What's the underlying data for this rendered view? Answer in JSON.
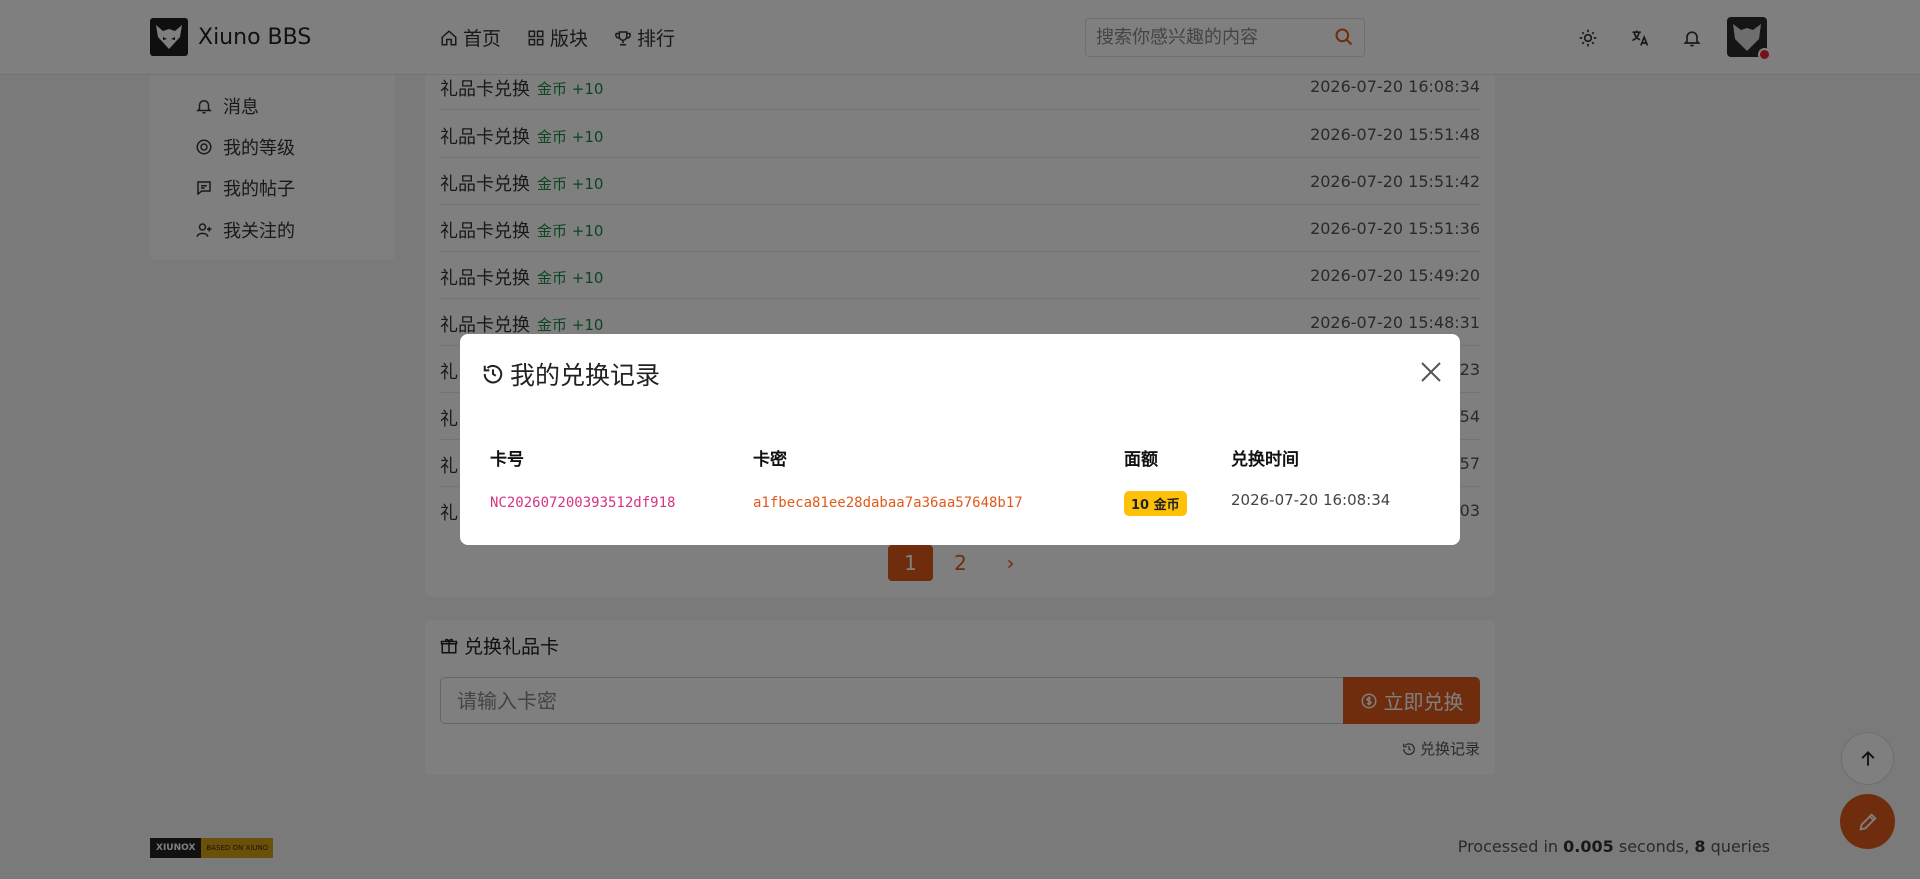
{
  "header": {
    "logo_text": "Xiuno BBS",
    "nav": [
      {
        "label": "首页",
        "icon": "home-icon"
      },
      {
        "label": "版块",
        "icon": "grid-icon"
      },
      {
        "label": "排行",
        "icon": "trophy-icon"
      }
    ],
    "search_placeholder": "搜索你感兴趣的内容",
    "icons": [
      "sun-icon",
      "translate-icon",
      "bell-icon"
    ]
  },
  "sidebar": {
    "items": [
      {
        "label": "消息",
        "icon": "bell-icon"
      },
      {
        "label": "我的等级",
        "icon": "level-icon"
      },
      {
        "label": "我的帖子",
        "icon": "comment-icon"
      },
      {
        "label": "我关注的",
        "icon": "user-plus-icon"
      }
    ]
  },
  "records": {
    "rows": [
      {
        "title": "礼品卡兑换",
        "gain": "金币 +10",
        "time": "2026-07-20 16:08:34"
      },
      {
        "title": "礼品卡兑换",
        "gain": "金币 +10",
        "time": "2026-07-20 15:51:48"
      },
      {
        "title": "礼品卡兑换",
        "gain": "金币 +10",
        "time": "2026-07-20 15:51:42"
      },
      {
        "title": "礼品卡兑换",
        "gain": "金币 +10",
        "time": "2026-07-20 15:51:36"
      },
      {
        "title": "礼品卡兑换",
        "gain": "金币 +10",
        "time": "2026-07-20 15:49:20"
      },
      {
        "title": "礼品卡兑换",
        "gain": "金币 +10",
        "time": "2026-07-20 15:48:31"
      },
      {
        "title": "礼",
        "gain": "",
        "time": ":23"
      },
      {
        "title": "礼",
        "gain": "",
        "time": ":54"
      },
      {
        "title": "礼",
        "gain": "",
        "time": ":57"
      },
      {
        "title": "礼",
        "gain": "",
        "time": ":03"
      }
    ],
    "pages": [
      "1",
      "2",
      "›"
    ]
  },
  "redeem": {
    "title": "兑换礼品卡",
    "input_placeholder": "请输入卡密",
    "button_label": "立即兑换",
    "history_link": "兑换记录"
  },
  "footer": {
    "badge_left": "XIUNOX",
    "badge_right": "BASED ON XIUNO",
    "processed_prefix": "Processed in ",
    "processed_seconds": "0.005",
    "processed_mid": " seconds, ",
    "processed_queries": "8",
    "processed_suffix": " queries"
  },
  "modal": {
    "title": "我的兑换记录",
    "headers": {
      "card_no": "卡号",
      "card_key": "卡密",
      "value": "面额",
      "time": "兑换时间"
    },
    "row": {
      "card_no": "NC202607200393512df918",
      "card_key": "a1fbeca81ee28dabaa7a36aa57648b17",
      "value": "10 金币",
      "time": "2026-07-20 16:08:34"
    }
  },
  "colors": {
    "accent": "#e05a1b",
    "success": "#1a8a45",
    "badge": "#ffc107",
    "card_no": "#d63384"
  }
}
